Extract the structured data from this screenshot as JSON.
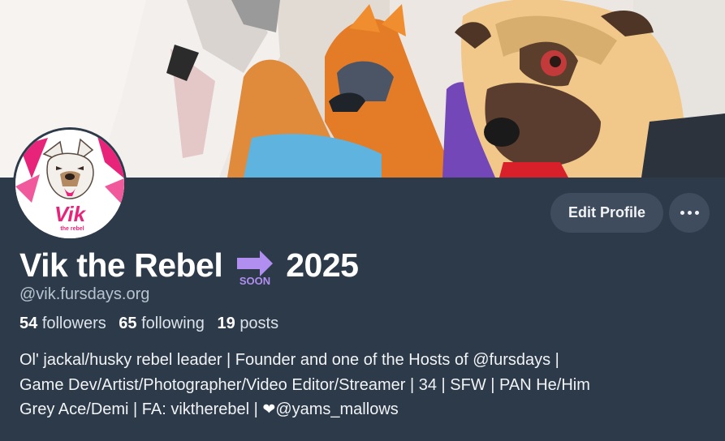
{
  "profile": {
    "display_name_before": "Vik the Rebel",
    "emoji_label": "SOON",
    "display_name_after": "2025",
    "handle": "@vik.fursdays.org",
    "stats": {
      "followers_count": "54",
      "followers_label": "followers",
      "following_count": "65",
      "following_label": "following",
      "posts_count": "19",
      "posts_label": "posts"
    },
    "bio": {
      "line1": "Ol' jackal/husky rebel leader | Founder and one of the Hosts of @fursdays |",
      "line2": "Game Dev/Artist/Photographer/Video Editor/Streamer | 34 | SFW | PAN He/Him",
      "line3_before": "Grey Ace/Demi | FA: viktherebel | ",
      "line3_heart": "❤",
      "line3_after": "@yams_mallows"
    }
  },
  "actions": {
    "edit_label": "Edit Profile",
    "more_icon": "ellipsis-icon"
  },
  "avatar": {
    "logo_text": "Vik",
    "logo_subtext": "the rebel"
  },
  "colors": {
    "background": "#2c3a4a",
    "button": "#3e4c5e",
    "handle_text": "#b8c3cf",
    "accent_pink": "#e7247a",
    "soon_purple": "#b08ff0"
  }
}
